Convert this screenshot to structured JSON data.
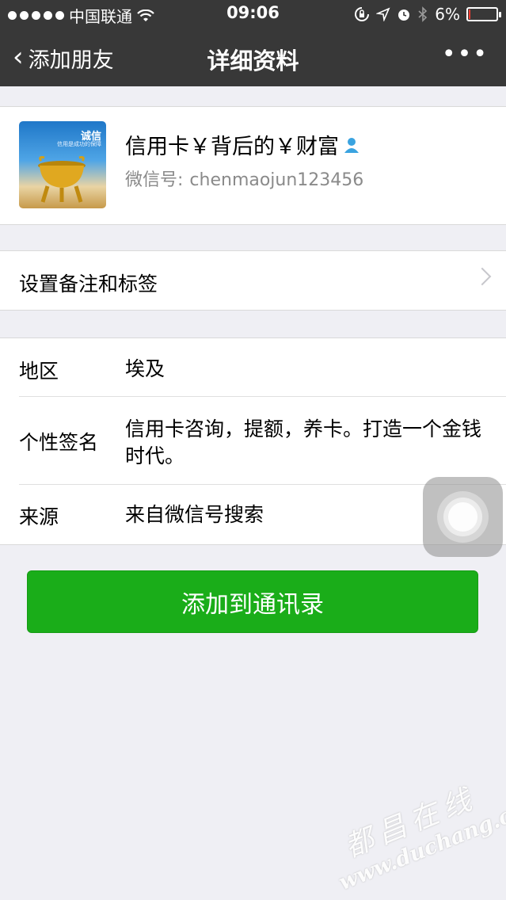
{
  "status_bar": {
    "carrier": "中国联通",
    "time": "09:06",
    "battery_text": "6%",
    "battery_level": 0.06,
    "icons": [
      "signal-dots-icon",
      "wifi-icon",
      "rotation-lock-icon",
      "location-icon",
      "alarm-icon",
      "bluetooth-icon",
      "battery-icon"
    ]
  },
  "nav": {
    "back_label": "添加朋友",
    "title": "详细资料",
    "more_label": "•••"
  },
  "profile": {
    "name": "信用卡￥背后的￥财富",
    "wechat_id_label": "微信号:",
    "wechat_id": "chenmaojun123456",
    "avatar_title": "诚信",
    "avatar_subtitle": "信用是成功的保障"
  },
  "remark": {
    "label": "设置备注和标签"
  },
  "details": [
    {
      "key": "地区",
      "value": "埃及"
    },
    {
      "key": "个性签名",
      "value": "信用卡咨询，提额，养卡。打造一个金钱时代。"
    },
    {
      "key": "来源",
      "value": "来自微信号搜索"
    }
  ],
  "add_button": {
    "label": "添加到通讯录",
    "color": "#1aad19"
  },
  "watermark": {
    "line1": "都昌在线",
    "line2": "www.duchang.org"
  }
}
